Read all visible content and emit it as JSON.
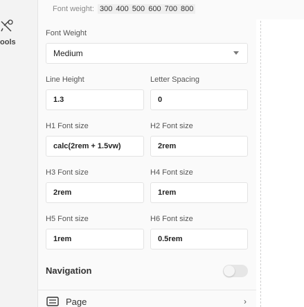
{
  "sidebar": {
    "tools_label": "ools"
  },
  "font_weight_line": {
    "prefix": "Font weight:",
    "weights": "300 400 500 600 700 800"
  },
  "font_weight": {
    "label": "Font Weight",
    "value": "Medium"
  },
  "line_height": {
    "label": "Line Height",
    "value": "1.3"
  },
  "letter_spacing": {
    "label": "Letter Spacing",
    "value": "0"
  },
  "h1": {
    "label": "H1 Font size",
    "value": "calc(2rem + 1.5vw)"
  },
  "h2": {
    "label": "H2 Font size",
    "value": "2rem"
  },
  "h3": {
    "label": "H3 Font size",
    "value": "2rem"
  },
  "h4": {
    "label": "H4 Font size",
    "value": "1rem"
  },
  "h5": {
    "label": "H5 Font size",
    "value": "1rem"
  },
  "h6": {
    "label": "H6 Font size",
    "value": "0.5rem"
  },
  "navigation": {
    "title": "Navigation",
    "toggle_on": false
  },
  "page": {
    "label": "Page"
  },
  "icons": {
    "tools": "tools-icon",
    "caret": "caret-down-icon",
    "page": "page-icon",
    "chevron": "chevron-right-icon"
  }
}
